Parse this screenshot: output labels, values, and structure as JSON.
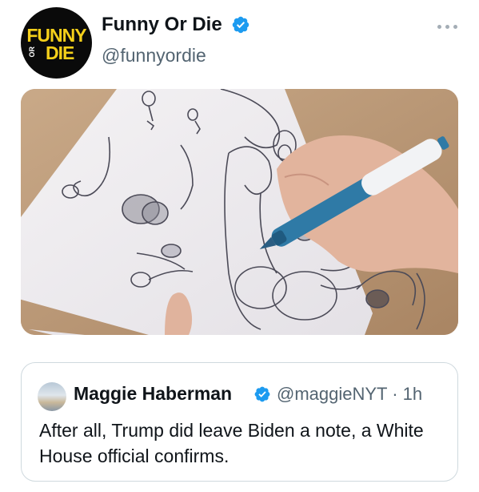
{
  "tweet": {
    "avatar": {
      "line1": "FUNNY",
      "line2": "DIE",
      "or_text": "OR"
    },
    "display_name": "Funny Or Die",
    "handle": "@funnyordie",
    "more_icon": "more-dots-icon",
    "verified_icon": "verified-badge-icon",
    "verified_color": "#1d9bf0"
  },
  "quoted_tweet": {
    "display_name": "Maggie Haberman",
    "handle_time": "@maggieNYT · 1h",
    "text": "After all, Trump did leave Biden a note, a White House official confirms."
  }
}
